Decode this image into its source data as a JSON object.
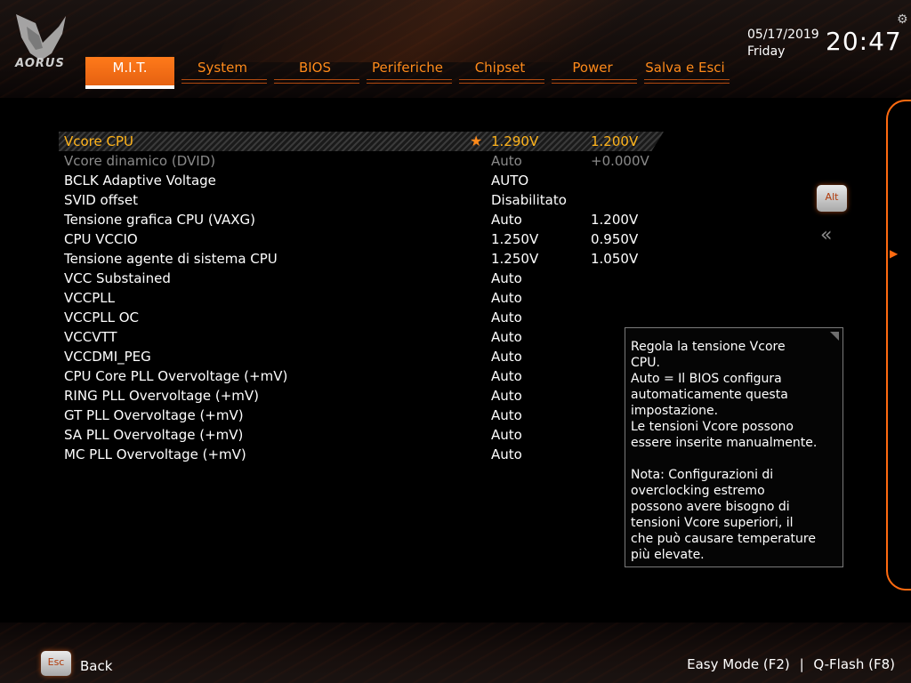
{
  "header": {
    "logo_text": "AORUS",
    "date": "05/17/2019",
    "day": "Friday",
    "time": "20:47",
    "tabs": [
      {
        "label": "M.I.T.",
        "active": true
      },
      {
        "label": "System",
        "active": false
      },
      {
        "label": "BIOS",
        "active": false
      },
      {
        "label": "Periferiche",
        "active": false
      },
      {
        "label": "Chipset",
        "active": false
      },
      {
        "label": "Power",
        "active": false
      },
      {
        "label": "Salva e Esci",
        "active": false
      }
    ]
  },
  "settings": [
    {
      "label": "Vcore CPU",
      "value1": "1.290V",
      "value2": "1.200V",
      "state": "selected"
    },
    {
      "label": "Vcore dinamico (DVID)",
      "value1": "Auto",
      "value2": "+0.000V",
      "state": "disabled"
    },
    {
      "label": "BCLK Adaptive Voltage",
      "value1": "AUTO",
      "value2": "",
      "state": "normal"
    },
    {
      "label": "SVID offset",
      "value1": "Disabilitato",
      "value2": "",
      "state": "normal"
    },
    {
      "label": "Tensione grafica CPU (VAXG)",
      "value1": "Auto",
      "value2": "1.200V",
      "state": "normal"
    },
    {
      "label": "CPU VCCIO",
      "value1": "1.250V",
      "value2": "0.950V",
      "state": "normal"
    },
    {
      "label": "Tensione agente di sistema CPU",
      "value1": "1.250V",
      "value2": "1.050V",
      "state": "normal"
    },
    {
      "label": "VCC Substained",
      "value1": "Auto",
      "value2": "",
      "state": "normal"
    },
    {
      "label": "VCCPLL",
      "value1": "Auto",
      "value2": "",
      "state": "normal"
    },
    {
      "label": "VCCPLL OC",
      "value1": "Auto",
      "value2": "",
      "state": "normal"
    },
    {
      "label": "VCCVTT",
      "value1": "Auto",
      "value2": "",
      "state": "normal"
    },
    {
      "label": "VCCDMI_PEG",
      "value1": "Auto",
      "value2": "",
      "state": "normal"
    },
    {
      "label": "CPU Core PLL Overvoltage (+mV)",
      "value1": "Auto",
      "value2": "",
      "state": "normal"
    },
    {
      "label": "RING PLL Overvoltage (+mV)",
      "value1": "Auto",
      "value2": "",
      "state": "normal"
    },
    {
      "label": "GT PLL Overvoltage (+mV)",
      "value1": "Auto",
      "value2": "",
      "state": "normal"
    },
    {
      "label": "SA PLL Overvoltage (+mV)",
      "value1": "Auto",
      "value2": "",
      "state": "normal"
    },
    {
      "label": "MC PLL Overvoltage (+mV)",
      "value1": "Auto",
      "value2": "",
      "state": "normal"
    }
  ],
  "help": {
    "text": "Regola la tensione Vcore\nCPU.\nAuto = Il BIOS configura\nautomaticamente questa\nimpostazione.\nLe tensioni Vcore possono\nessere inserite manualmente.\n\nNota: Configurazioni di\noverclocking estremo\npossono avere bisogno di\ntensioni Vcore superiori, il\nche può causare temperature\npiù elevate."
  },
  "side": {
    "alt_key": "Alt"
  },
  "footer": {
    "esc_key": "Esc",
    "back_label": "Back",
    "easy_mode": "Easy Mode (F2)",
    "separator": "|",
    "qflash": "Q-Flash (F8)"
  },
  "colors": {
    "accent": "#ff7a1a",
    "selected_text": "#ffb31a",
    "disabled_text": "#8a8a8a"
  }
}
